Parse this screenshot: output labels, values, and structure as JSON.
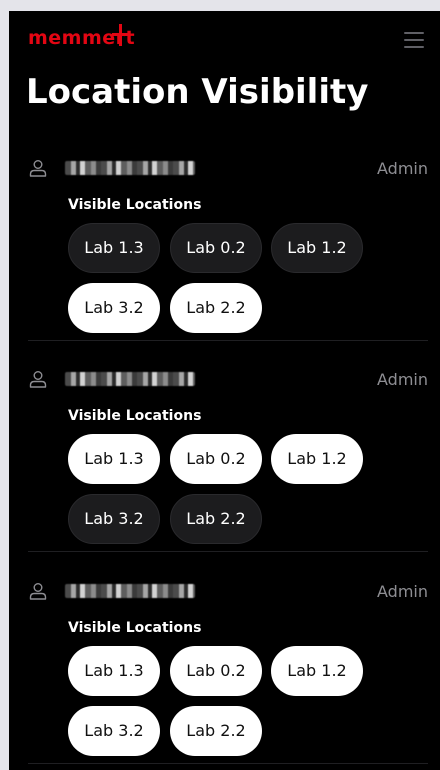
{
  "app": {
    "brand": "memmert",
    "brand_color": "#e30613",
    "menu_icon": "hamburger-menu-icon"
  },
  "page": {
    "title": "Location Visibility"
  },
  "users": [
    {
      "role": "Admin",
      "avatar_icon": "user-icon",
      "visible_label": "Visible Locations",
      "locations": [
        {
          "label": "Lab 1.3",
          "selected": false
        },
        {
          "label": "Lab 0.2",
          "selected": false
        },
        {
          "label": "Lab 1.2",
          "selected": false
        },
        {
          "label": "Lab 3.2",
          "selected": true
        },
        {
          "label": "Lab 2.2",
          "selected": true
        }
      ]
    },
    {
      "role": "Admin",
      "avatar_icon": "user-icon",
      "visible_label": "Visible Locations",
      "locations": [
        {
          "label": "Lab 1.3",
          "selected": true
        },
        {
          "label": "Lab 0.2",
          "selected": true
        },
        {
          "label": "Lab 1.2",
          "selected": true
        },
        {
          "label": "Lab 3.2",
          "selected": false
        },
        {
          "label": "Lab 2.2",
          "selected": false
        }
      ]
    },
    {
      "role": "Admin",
      "avatar_icon": "user-icon",
      "visible_label": "Visible Locations",
      "locations": [
        {
          "label": "Lab 1.3",
          "selected": true
        },
        {
          "label": "Lab 0.2",
          "selected": true
        },
        {
          "label": "Lab 1.2",
          "selected": true
        },
        {
          "label": "Lab 3.2",
          "selected": true
        },
        {
          "label": "Lab 2.2",
          "selected": true
        }
      ]
    }
  ]
}
